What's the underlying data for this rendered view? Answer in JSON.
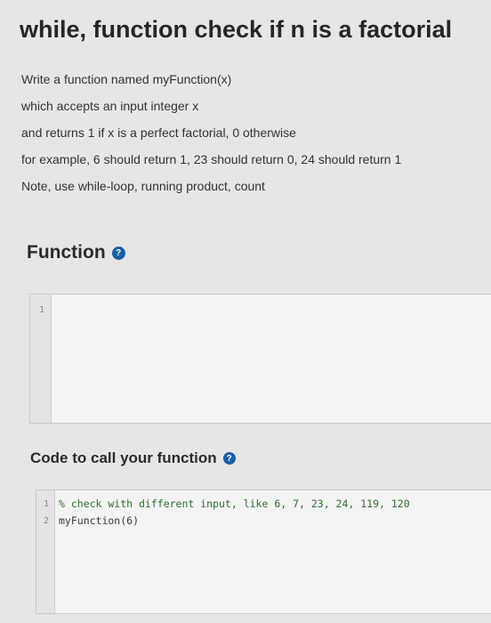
{
  "question": {
    "title": "while, function check if n is a factorial",
    "description": [
      "Write a function named myFunction(x)",
      "which accepts an input integer x",
      "and returns 1 if x is a perfect factorial, 0 otherwise",
      "for example, 6 should return 1, 23 should return 0, 24 should return 1",
      "Note, use while-loop, running product, count"
    ]
  },
  "function_section": {
    "heading": "Function",
    "help_icon": "question-circle-icon",
    "editor": {
      "lines": [
        {
          "number": "1",
          "code": ""
        }
      ]
    }
  },
  "call_section": {
    "heading": "Code to call your function",
    "help_icon": "question-circle-icon",
    "editor": {
      "lines": [
        {
          "number": "1",
          "code": "% check with different input, like 6, 7, 23, 24, 119, 120"
        },
        {
          "number": "2",
          "code": "myFunction(6)"
        }
      ]
    }
  },
  "colors": {
    "page_background": "#e6e6e6",
    "help_icon": "#1a5fa8",
    "comment_text": "#2e6e2e"
  }
}
